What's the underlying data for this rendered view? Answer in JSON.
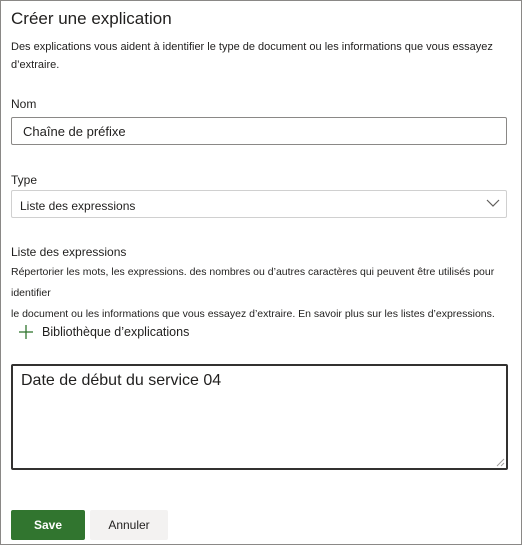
{
  "dialog": {
    "title": "Créer une explication",
    "description": "Des explications vous aident à identifier le type de document ou les informations que vous essayez d’extraire."
  },
  "fields": {
    "name_label": "Nom",
    "name_value": "Chaîne de préfixe",
    "type_label": "Type",
    "type_value": "Liste des expressions",
    "list_label": "Liste des expressions",
    "list_description_line1": "Répertorier les mots, les expressions. des nombres ou d’autres caractères qui peuvent être utilisés pour identifier",
    "list_description_line2": "le document ou les informations que vous essayez d’extraire. En savoir plus sur les listes d’expressions.",
    "library_label": "Bibliothèque d’explications",
    "expressions_value": "Date de début du service 04"
  },
  "actions": {
    "save_label": "Save",
    "cancel_label": "Annuler"
  },
  "colors": {
    "primary": "#31752f",
    "secondary_bg": "#f3f2f1",
    "text": "#201f1e"
  },
  "icons": {
    "add": "plus-icon",
    "dropdown": "chevron-down-icon",
    "resize": "resize-grip-icon"
  }
}
